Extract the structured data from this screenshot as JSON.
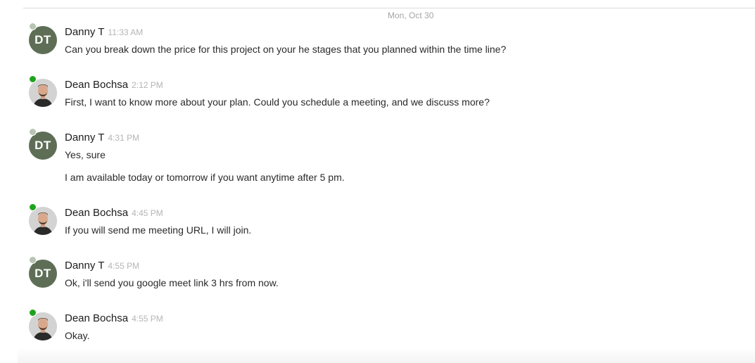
{
  "date_divider": "Mon, Oct 30",
  "messages": [
    {
      "sender": "Danny T",
      "initials": "DT",
      "time": "11:33 AM",
      "lines": [
        "Can you break down the price for this project on your he stages that you planned within the time line?"
      ]
    },
    {
      "sender": "Dean Bochsa",
      "time": "2:12 PM",
      "lines": [
        "First, I want to know more about your plan. Could you schedule a meeting, and we discuss more?"
      ]
    },
    {
      "sender": "Danny T",
      "initials": "DT",
      "time": "4:31 PM",
      "lines": [
        "Yes, sure",
        "I am available today or tomorrow if you want anytime after 5 pm."
      ]
    },
    {
      "sender": "Dean Bochsa",
      "time": "4:45 PM",
      "lines": [
        "If you will send me meeting URL, I will join."
      ]
    },
    {
      "sender": "Danny T",
      "initials": "DT",
      "time": "4:55 PM",
      "lines": [
        "Ok, i'll send you google meet link 3 hrs from now."
      ]
    },
    {
      "sender": "Dean Bochsa",
      "time": "4:55 PM",
      "lines": [
        "Okay."
      ]
    }
  ],
  "colors": {
    "dt_avatar_bg": "#5e6e56",
    "online_dot": "#1fa31f",
    "offline_dot": "#b8c4b2",
    "timestamp": "#b5b5b5"
  }
}
